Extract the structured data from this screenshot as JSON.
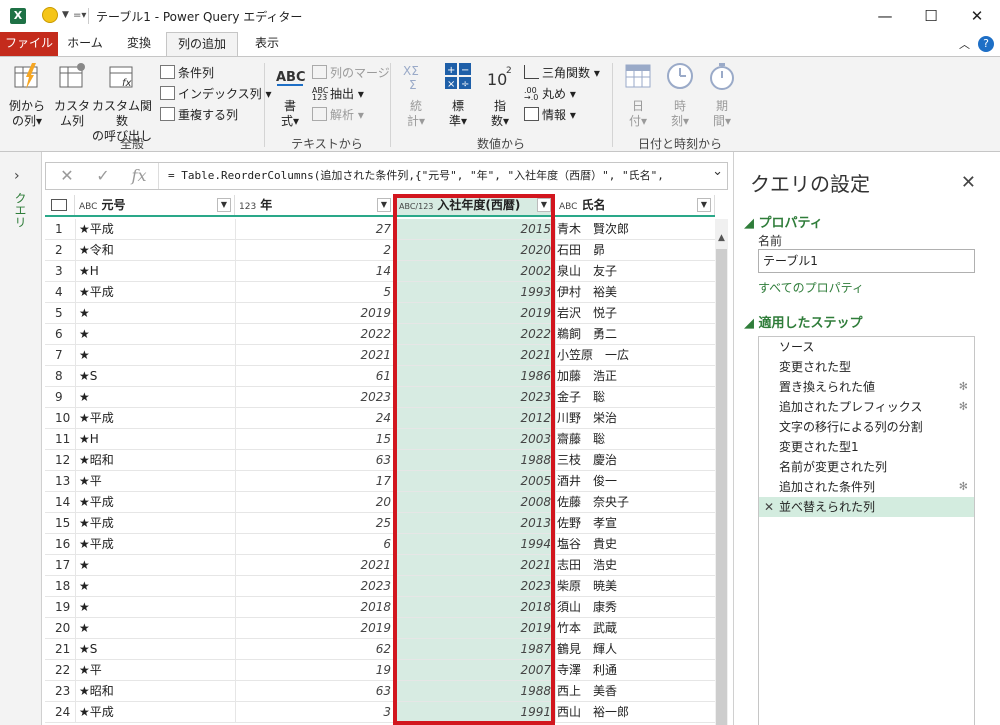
{
  "window": {
    "title": "テーブル1 - Power Query エディター",
    "minimize": "—",
    "maximize": "☐",
    "close": "✕"
  },
  "tabs": [
    "ファイル",
    "ホーム",
    "変換",
    "列の追加",
    "表示"
  ],
  "ribbon": {
    "general": {
      "example_col": [
        "例から",
        "の列"
      ],
      "custom_col": [
        "カスタ",
        "ム列"
      ],
      "invoke_fn": [
        "カスタム関数",
        "の呼び出し"
      ],
      "conditional": "条件列",
      "index": "インデックス列",
      "duplicate": "重複する列",
      "group": "全般"
    },
    "text": {
      "format": [
        "書",
        "式"
      ],
      "merge": "列のマージ",
      "extract": "抽出",
      "parse": "解析",
      "group": "テキストから"
    },
    "number": {
      "stats": [
        "統",
        "計"
      ],
      "standard": [
        "標",
        "準"
      ],
      "scientific": [
        "指",
        "数"
      ],
      "trig": "三角関数",
      "rounding": "丸め",
      "info": "情報",
      "group": "数値から"
    },
    "datetime": {
      "date": [
        "日",
        "付"
      ],
      "time": [
        "時",
        "刻"
      ],
      "duration": [
        "期",
        "間"
      ],
      "group": "日付と時刻から"
    }
  },
  "left_pane": {
    "label": "クエリ"
  },
  "formula": {
    "text": "= Table.ReorderColumns(追加された条件列,{\"元号\", \"年\", \"入社年度（西暦）\", \"氏名\","
  },
  "columns": [
    {
      "type": "ABC",
      "name": "元号"
    },
    {
      "type": "123",
      "name": "年"
    },
    {
      "type": "ABC/123",
      "name": "入社年度(西暦)"
    },
    {
      "type": "ABC",
      "name": "氏名"
    }
  ],
  "rows": [
    [
      "1",
      "★平成",
      "27",
      "2015",
      "青木　賢次郎"
    ],
    [
      "2",
      "★令和",
      "2",
      "2020",
      "石田　昴"
    ],
    [
      "3",
      "★H",
      "14",
      "2002",
      "泉山　友子"
    ],
    [
      "4",
      "★平成",
      "5",
      "1993",
      "伊村　裕美"
    ],
    [
      "5",
      "★",
      "2019",
      "2019",
      "岩沢　悦子"
    ],
    [
      "6",
      "★",
      "2022",
      "2022",
      "鵜飼　勇二"
    ],
    [
      "7",
      "★",
      "2021",
      "2021",
      "小笠原　一広"
    ],
    [
      "8",
      "★S",
      "61",
      "1986",
      "加藤　浩正"
    ],
    [
      "9",
      "★",
      "2023",
      "2023",
      "金子　聡"
    ],
    [
      "10",
      "★平成",
      "24",
      "2012",
      "川野　栄治"
    ],
    [
      "11",
      "★H",
      "15",
      "2003",
      "齋藤　聡"
    ],
    [
      "12",
      "★昭和",
      "63",
      "1988",
      "三枝　慶治"
    ],
    [
      "13",
      "★平",
      "17",
      "2005",
      "酒井　俊一"
    ],
    [
      "14",
      "★平成",
      "20",
      "2008",
      "佐藤　奈央子"
    ],
    [
      "15",
      "★平成",
      "25",
      "2013",
      "佐野　孝宣"
    ],
    [
      "16",
      "★平成",
      "6",
      "1994",
      "塩谷　貴史"
    ],
    [
      "17",
      "★",
      "2021",
      "2021",
      "志田　浩史"
    ],
    [
      "18",
      "★",
      "2023",
      "2023",
      "柴原　暁美"
    ],
    [
      "19",
      "★",
      "2018",
      "2018",
      "須山　康秀"
    ],
    [
      "20",
      "★",
      "2019",
      "2019",
      "竹本　武蔵"
    ],
    [
      "21",
      "★S",
      "62",
      "1987",
      "鶴見　輝人"
    ],
    [
      "22",
      "★平",
      "19",
      "2007",
      "寺澤　利通"
    ],
    [
      "23",
      "★昭和",
      "63",
      "1988",
      "西上　美香"
    ],
    [
      "24",
      "★平成",
      "3",
      "1991",
      "西山　裕一郎"
    ]
  ],
  "settings": {
    "title": "クエリの設定",
    "properties": "プロパティ",
    "name_label": "名前",
    "name_value": "テーブル1",
    "all_props": "すべてのプロパティ",
    "applied_steps": "適用したステップ",
    "steps": [
      {
        "label": "ソース",
        "gear": false
      },
      {
        "label": "変更された型",
        "gear": false
      },
      {
        "label": "置き換えられた値",
        "gear": true
      },
      {
        "label": "追加されたプレフィックス",
        "gear": true
      },
      {
        "label": "文字の移行による列の分割",
        "gear": false
      },
      {
        "label": "変更された型1",
        "gear": false
      },
      {
        "label": "名前が変更された列",
        "gear": false
      },
      {
        "label": "追加された条件列",
        "gear": true
      },
      {
        "label": "並べ替えられた列",
        "gear": false,
        "selected": true
      }
    ]
  },
  "colors": {
    "accent": "#2aa889",
    "file_tab": "#c42b1c",
    "highlight": "#d2161e",
    "selected_col": "#d7ebe2"
  }
}
